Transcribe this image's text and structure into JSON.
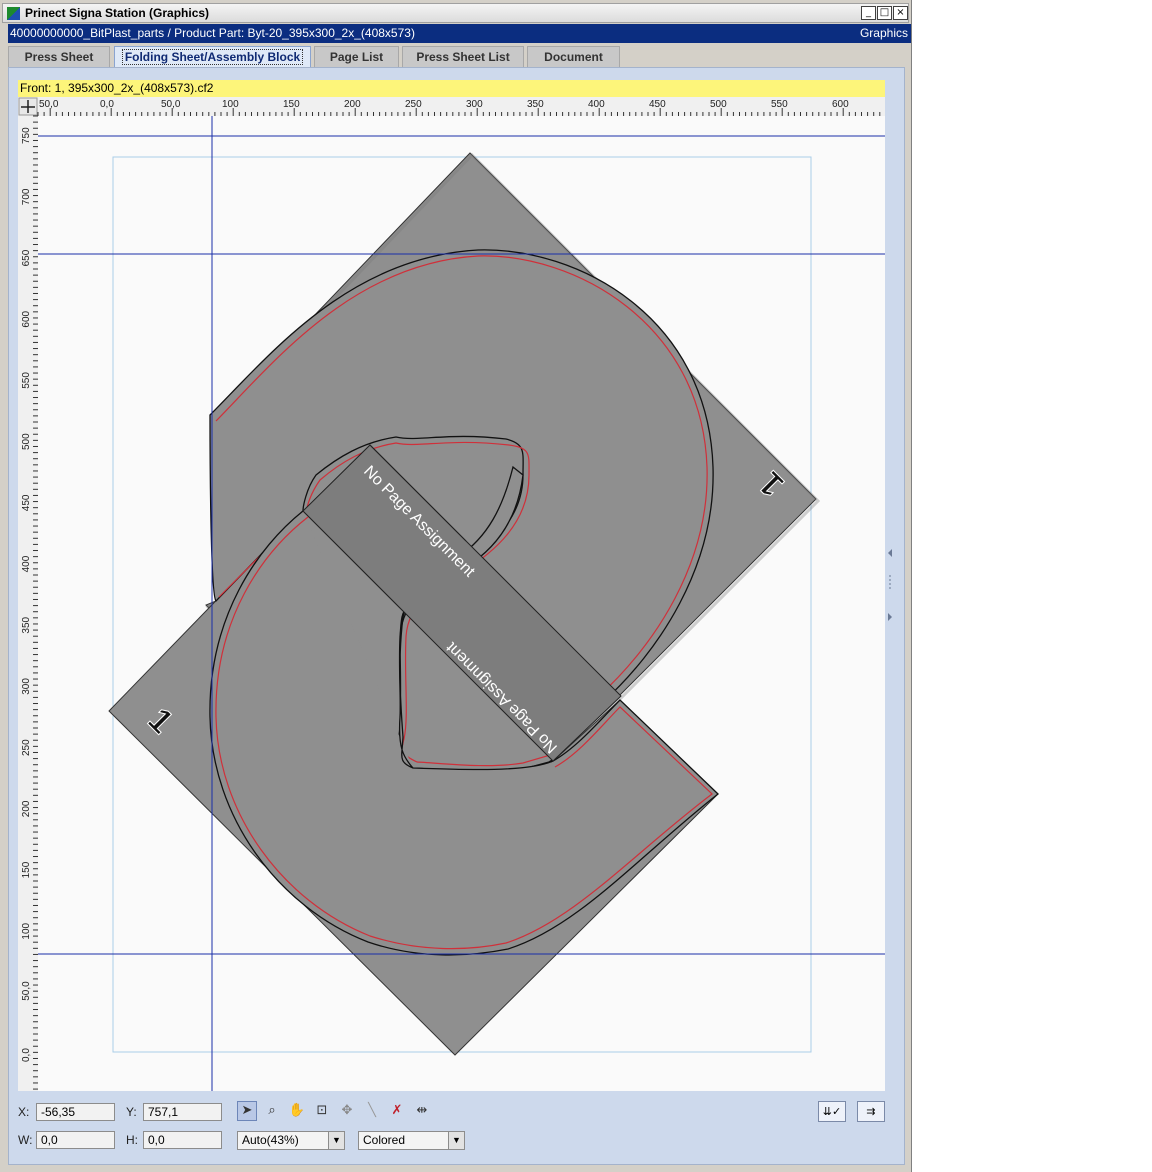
{
  "window": {
    "title": "Prinect Signa Station (Graphics)",
    "path": "40000000000_BitPlast_parts / Product Part: Byt-20_395x300_2x_(408x573)",
    "mode": "Graphics",
    "controls": [
      "_",
      "□",
      "×"
    ]
  },
  "tabs": [
    {
      "label": "Press Sheet",
      "active": false
    },
    {
      "label": "Folding Sheet/Assembly Block",
      "active": true
    },
    {
      "label": "Page List",
      "active": false
    },
    {
      "label": "Press Sheet List",
      "active": false
    },
    {
      "label": "Document",
      "active": false
    }
  ],
  "sheet_header": "Front:  1, 395x300_2x_(408x573).cf2",
  "ruler": {
    "top_labels": [
      "50,0",
      "0,0",
      "50,0",
      "100",
      "150",
      "200",
      "250",
      "300",
      "350",
      "400",
      "450",
      "500",
      "550",
      "600"
    ],
    "left_labels": [
      "750",
      "700",
      "650",
      "600",
      "550",
      "500",
      "450",
      "400",
      "350",
      "300",
      "250",
      "200",
      "150",
      "100",
      "50,0",
      "0,0"
    ]
  },
  "canvas": {
    "page_labels": [
      "No Page Assignment",
      "No Page Assignment"
    ],
    "page_numbers": [
      "1",
      "1"
    ],
    "colors": {
      "panel": "#8c8c8c",
      "cut": "#d0303a",
      "guide": "#1a2fa8",
      "frame": "#aacde8"
    }
  },
  "coords": {
    "x_label": "X:",
    "x_value": "-56,35",
    "y_label": "Y:",
    "y_value": "757,1",
    "w_label": "W:",
    "w_value": "0,0",
    "h_label": "H:",
    "h_value": "0,0"
  },
  "tools": [
    "select-arrow-icon",
    "zoom-icon",
    "pan-hand-icon",
    "crop-icon",
    "move-icon",
    "measure-line-icon",
    "no-print-icon",
    "fit-width-icon"
  ],
  "zoom": {
    "value": "Auto(43%)"
  },
  "display": {
    "value": "Colored"
  }
}
